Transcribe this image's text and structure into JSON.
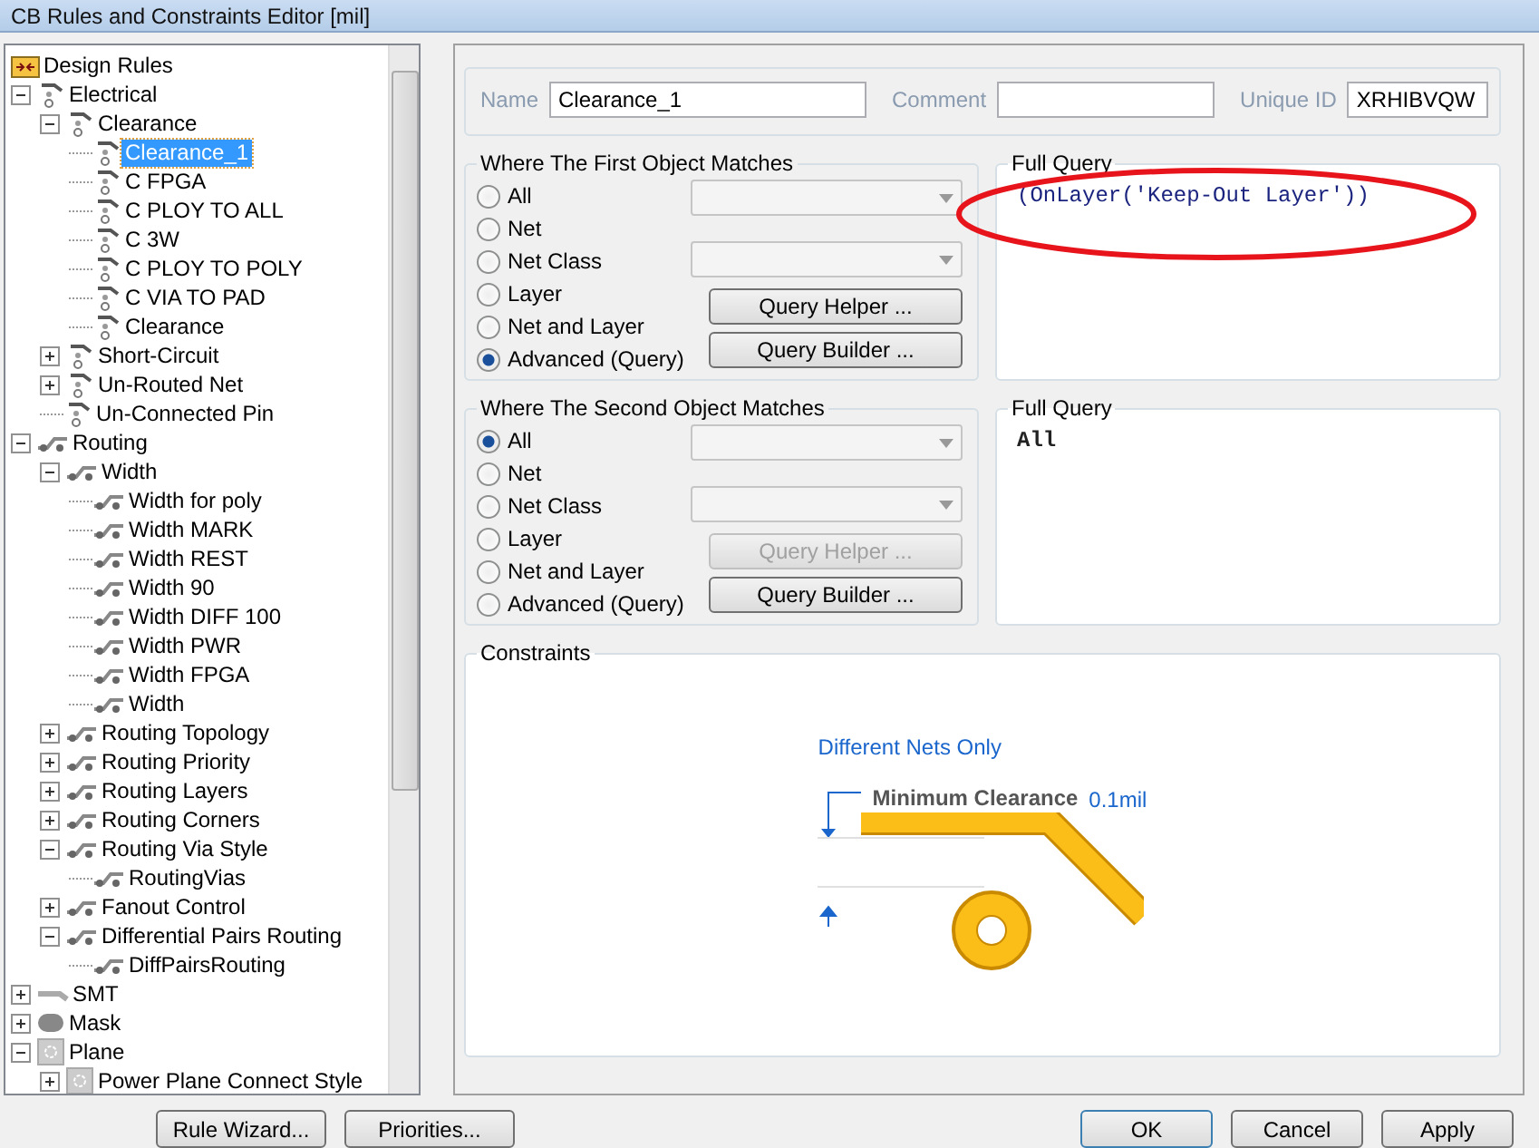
{
  "window": {
    "title": "CB Rules and Constraints Editor [mil]"
  },
  "tree": {
    "label": "Design Rules",
    "kind": "rules",
    "children": [
      {
        "label": "Electrical",
        "kind": "electrical",
        "expanded": true,
        "selected": false,
        "children": [
          {
            "label": "Clearance",
            "expanded": true,
            "selected": false,
            "children": [
              {
                "label": "Clearance_1",
                "selected": true
              },
              {
                "label": "C FPGA",
                "selected": false
              },
              {
                "label": "C PLOY TO ALL",
                "selected": false
              },
              {
                "label": "C 3W",
                "selected": false
              },
              {
                "label": "C PLOY TO POLY",
                "selected": false
              },
              {
                "label": "C VIA TO PAD",
                "selected": false
              },
              {
                "label": "Clearance",
                "selected": false
              }
            ]
          },
          {
            "label": "Short-Circuit",
            "expanded": false,
            "selected": false
          },
          {
            "label": "Un-Routed Net",
            "expanded": false,
            "selected": false
          },
          {
            "label": "Un-Connected Pin",
            "selected": false
          }
        ]
      },
      {
        "label": "Routing",
        "kind": "routing",
        "expanded": true,
        "selected": false,
        "children": [
          {
            "label": "Width",
            "expanded": true,
            "selected": false,
            "children": [
              {
                "label": "Width for poly",
                "selected": false
              },
              {
                "label": "Width MARK",
                "selected": false
              },
              {
                "label": "Width REST",
                "selected": false
              },
              {
                "label": "Width 90",
                "selected": false
              },
              {
                "label": "Width DIFF 100",
                "selected": false
              },
              {
                "label": "Width PWR",
                "selected": false
              },
              {
                "label": "Width FPGA",
                "selected": false
              },
              {
                "label": "Width",
                "selected": false
              }
            ]
          },
          {
            "label": "Routing Topology",
            "expanded": false,
            "selected": false
          },
          {
            "label": "Routing Priority",
            "expanded": false,
            "selected": false
          },
          {
            "label": "Routing Layers",
            "expanded": false,
            "selected": false
          },
          {
            "label": "Routing Corners",
            "expanded": false,
            "selected": false
          },
          {
            "label": "Routing Via Style",
            "expanded": true,
            "selected": false,
            "children": [
              {
                "label": "RoutingVias",
                "selected": false
              }
            ]
          },
          {
            "label": "Fanout Control",
            "expanded": false,
            "selected": false
          },
          {
            "label": "Differential Pairs Routing",
            "expanded": true,
            "selected": false,
            "children": [
              {
                "label": "DiffPairsRouting",
                "selected": false
              }
            ]
          }
        ]
      },
      {
        "label": "SMT",
        "kind": "smt",
        "expanded": false,
        "selected": false
      },
      {
        "label": "Mask",
        "kind": "mask",
        "expanded": false,
        "selected": false
      },
      {
        "label": "Plane",
        "kind": "plane",
        "expanded": true,
        "selected": false,
        "children": [
          {
            "label": "Power Plane Connect Style",
            "expanded": false,
            "selected": false
          }
        ]
      }
    ]
  },
  "rule": {
    "name_label": "Name",
    "name": "Clearance_1",
    "comment_label": "Comment",
    "id_label": "Unique ID",
    "id": "XRHIBVQW"
  },
  "groups": [
    {
      "title": "Where The First Object Matches",
      "options": [
        {
          "label": "All",
          "selected": false
        },
        {
          "label": "Net",
          "selected": false
        },
        {
          "label": "Net Class",
          "selected": false
        },
        {
          "label": "Layer",
          "selected": false
        },
        {
          "label": "Net and Layer",
          "selected": false
        },
        {
          "label": "Advanced (Query)",
          "selected": true
        }
      ],
      "helper": {
        "label": "Query Helper ...",
        "disabled": false
      },
      "builder": {
        "label": "Query Builder ...",
        "disabled": false
      },
      "query_title": "Full Query",
      "query": "(OnLayer('Keep-Out Layer'))",
      "highlighted": true
    },
    {
      "title": "Where The Second Object Matches",
      "options": [
        {
          "label": "All",
          "selected": true
        },
        {
          "label": "Net",
          "selected": false
        },
        {
          "label": "Net Class",
          "selected": false
        },
        {
          "label": "Layer",
          "selected": false
        },
        {
          "label": "Net and Layer",
          "selected": false
        },
        {
          "label": "Advanced (Query)",
          "selected": false
        }
      ],
      "helper": {
        "label": "Query Helper ...",
        "disabled": true
      },
      "builder": {
        "label": "Query Builder ...",
        "disabled": false
      },
      "query_title": "Full Query",
      "query": "All",
      "highlighted": false
    }
  ],
  "constraints": {
    "title": "Constraints",
    "scope": "Different Nets Only",
    "label": "Minimum Clearance",
    "value": "0.1mil"
  },
  "left_buttons": [
    {
      "label": "Rule Wizard...",
      "default": false
    },
    {
      "label": "Priorities...",
      "default": false
    }
  ],
  "buttons": [
    {
      "label": "OK",
      "default": true
    },
    {
      "label": "Cancel",
      "default": false
    },
    {
      "label": "Apply",
      "default": false
    }
  ]
}
